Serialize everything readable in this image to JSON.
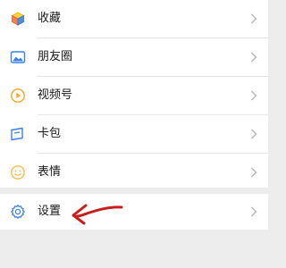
{
  "menu": {
    "items": [
      {
        "label": "收藏",
        "icon": "favorites-cube-icon"
      },
      {
        "label": "朋友圈",
        "icon": "moments-picture-icon"
      },
      {
        "label": "视频号",
        "icon": "channels-play-icon"
      },
      {
        "label": "卡包",
        "icon": "card-wallet-icon"
      },
      {
        "label": "表情",
        "icon": "sticker-smile-icon"
      }
    ],
    "settings": {
      "label": "设置",
      "icon": "gear-icon"
    }
  },
  "colors": {
    "background": "#ededed",
    "panel": "#ffffff",
    "blue": "#3b82e6",
    "orange": "#f5a623",
    "yellow": "#f2c14e",
    "annotation_red": "#c81e1e"
  }
}
